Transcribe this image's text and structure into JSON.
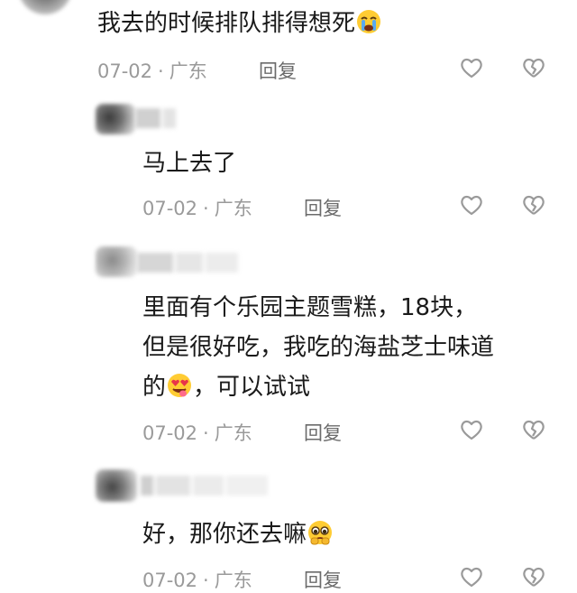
{
  "comments": [
    {
      "text": "我去的时候排队排得想死",
      "emoji": "crying-face-icon",
      "date": "07-02",
      "location": "广东",
      "reply_label": "回复"
    },
    {
      "text": "马上去了",
      "date": "07-02",
      "location": "广东",
      "reply_label": "回复"
    },
    {
      "lines": [
        "里面有个乐园主题雪糕，18块，",
        "但是很好吃，我吃的海盐芝士味道",
        "的",
        "，可以试试"
      ],
      "emoji": "heart-eyes-tongue-face-icon",
      "date": "07-02",
      "location": "广东",
      "reply_label": "回复"
    },
    {
      "text": "好，那你还去嘛",
      "emoji": "pleading-face-icon",
      "date": "07-02",
      "location": "广东",
      "reply_label": "回复"
    }
  ],
  "colors": {
    "text": "#1a1a1a",
    "meta": "#9a9a9a",
    "icon": "#9a9a9a"
  }
}
